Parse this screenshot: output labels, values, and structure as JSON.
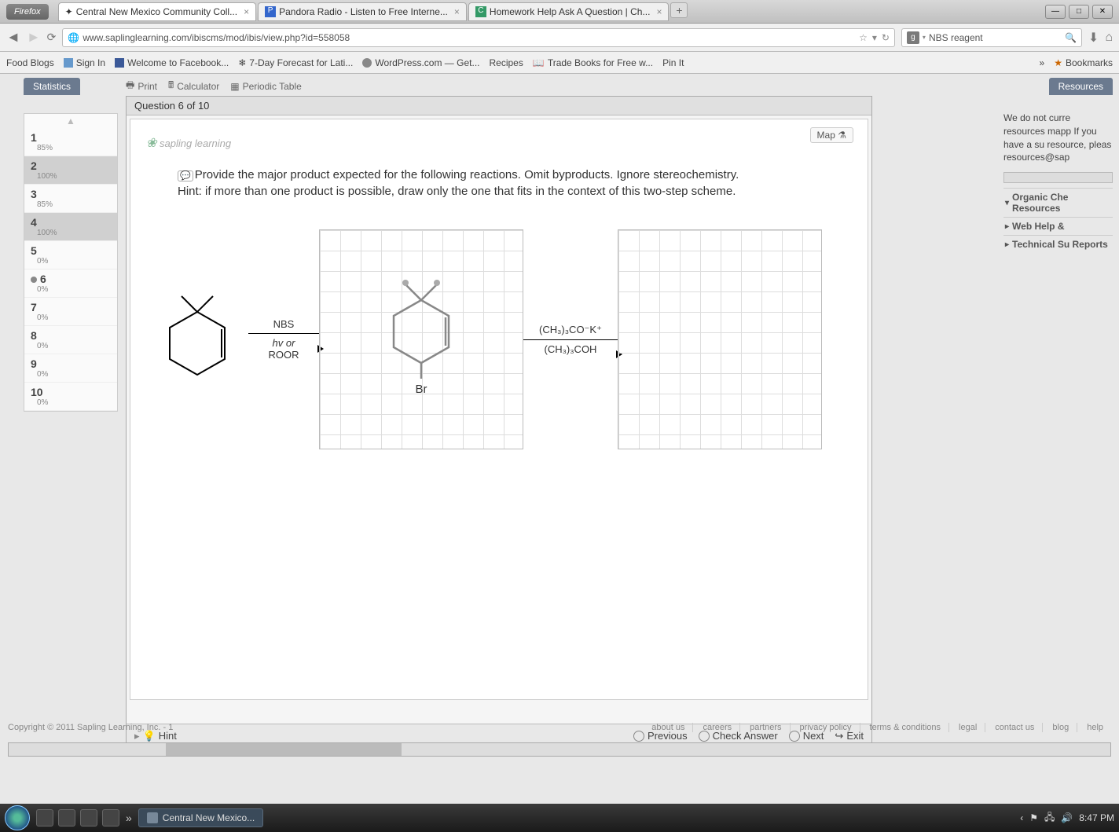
{
  "browser": {
    "name": "Firefox",
    "tabs": [
      {
        "title": "Central New Mexico Community Coll...",
        "active": true
      },
      {
        "title": "Pandora Radio - Listen to Free Interne...",
        "icon": "P"
      },
      {
        "title": "Homework Help Ask A Question | Ch...",
        "icon": "C"
      }
    ],
    "url": "www.saplinglearning.com/ibiscms/mod/ibis/view.php?id=558058",
    "search": {
      "value": "NBS reagent"
    },
    "bookmarks": [
      "Food Blogs",
      "Sign In",
      "Welcome to Facebook...",
      "7-Day Forecast for Lati...",
      "WordPress.com — Get...",
      "Recipes",
      "Trade Books for Free w...",
      "Pin It"
    ],
    "bookmarks_more": "Bookmarks"
  },
  "tabs_panel": {
    "left": "Statistics",
    "right": "Resources"
  },
  "toolbar": {
    "print": "Print",
    "calculator": "Calculator",
    "periodic": "Periodic Table"
  },
  "question_nav": [
    {
      "n": "1",
      "pct": "85%"
    },
    {
      "n": "2",
      "pct": "100%",
      "sel": true
    },
    {
      "n": "3",
      "pct": "85%"
    },
    {
      "n": "4",
      "pct": "100%",
      "sel": true
    },
    {
      "n": "5",
      "pct": "0%"
    },
    {
      "n": "6",
      "pct": "0%",
      "current": true
    },
    {
      "n": "7",
      "pct": "0%"
    },
    {
      "n": "8",
      "pct": "0%"
    },
    {
      "n": "9",
      "pct": "0%"
    },
    {
      "n": "10",
      "pct": "0%"
    }
  ],
  "question": {
    "header": "Question 6 of 10",
    "logo": "sapling learning",
    "map": "Map",
    "prompt_line1": "Provide the major product expected for the following reactions. Omit byproducts. Ignore stereochemistry.",
    "prompt_line2": "Hint: if more than one product is possible, draw only the one that fits in the context of this two-step scheme.",
    "reagent1_top": "NBS",
    "reagent1_bot1": "hv or",
    "reagent1_bot2": "ROOR",
    "product1_label": "Br",
    "reagent2_top": "(CH₃)₃CO⁻K⁺",
    "reagent2_bot": "(CH₃)₃COH",
    "hint": "Hint",
    "prev": "Previous",
    "check": "Check Answer",
    "next": "Next",
    "exit": "Exit"
  },
  "resources": {
    "text": "We do not curre resources mapp If you have a su resource, pleas resources@sap",
    "links": [
      "Organic Che Resources",
      "Web Help &",
      "Technical Su Reports"
    ]
  },
  "site_footer": {
    "copyright": "Copyright © 2011 Sapling Learning, Inc. - 1",
    "links": [
      "about us",
      "careers",
      "partners",
      "privacy policy",
      "terms & conditions",
      "legal",
      "contact us",
      "blog",
      "help"
    ]
  },
  "taskbar": {
    "task": "Central New Mexico...",
    "time": "8:47 PM"
  }
}
